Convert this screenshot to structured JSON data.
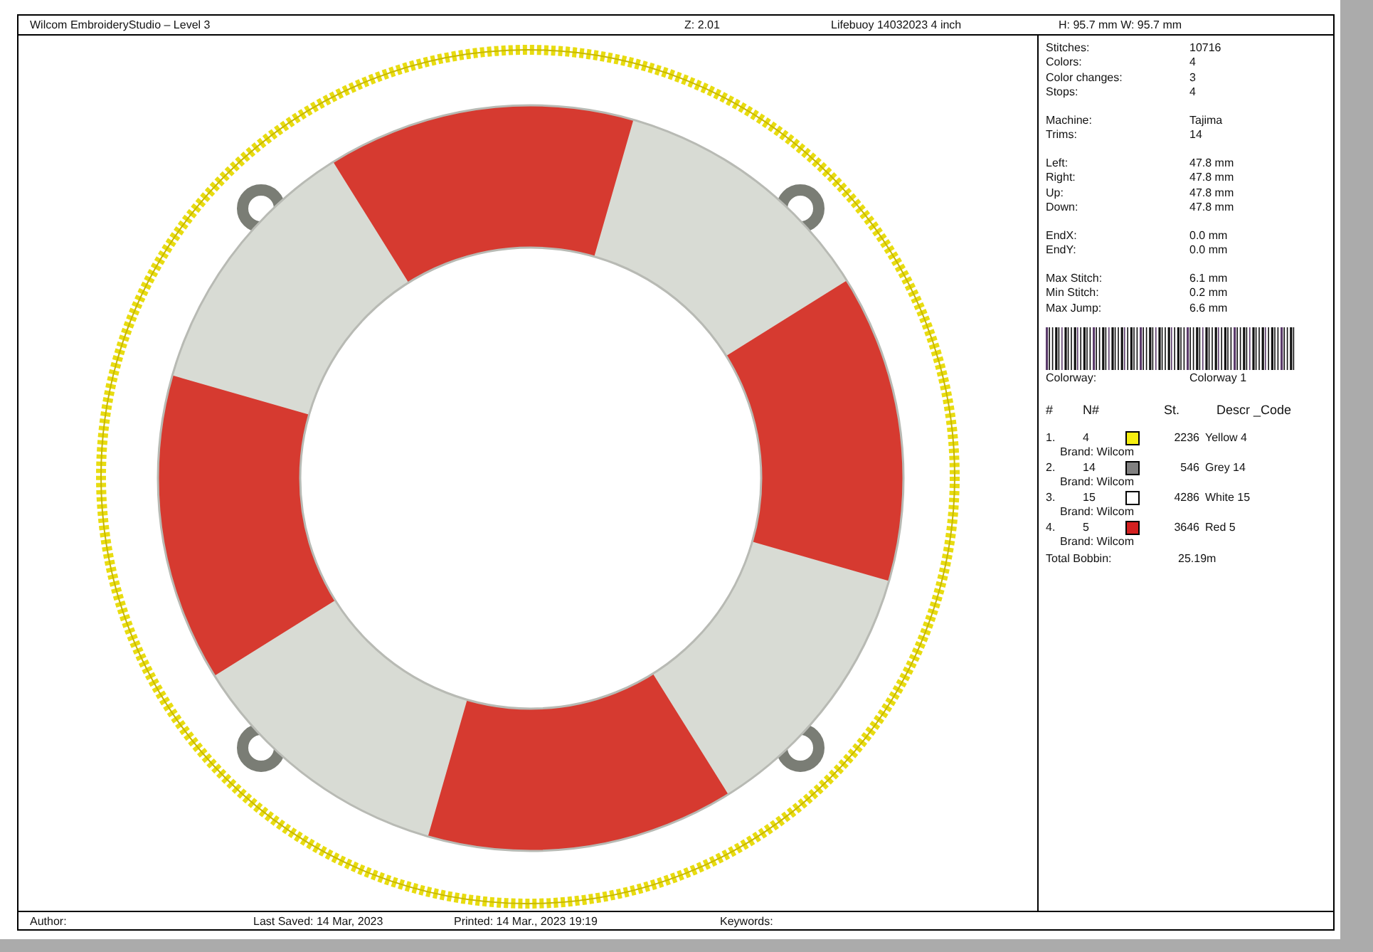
{
  "header": {
    "title": "Wilcom EmbroideryStudio – Level 3",
    "zoom": "Z: 2.01",
    "design_name": "Lifebuoy 14032023 4 inch",
    "size": "H: 95.7 mm   W: 95.7 mm"
  },
  "stat_groups": [
    [
      {
        "label": "Stitches:",
        "value": "10716"
      },
      {
        "label": "Colors:",
        "value": "4"
      },
      {
        "label": "Color changes:",
        "value": "3"
      },
      {
        "label": "Stops:",
        "value": "4"
      }
    ],
    [
      {
        "label": "Machine:",
        "value": "Tajima"
      },
      {
        "label": "Trims:",
        "value": "14"
      }
    ],
    [
      {
        "label": "Left:",
        "value": "47.8 mm"
      },
      {
        "label": "Right:",
        "value": "47.8 mm"
      },
      {
        "label": "Up:",
        "value": "47.8 mm"
      },
      {
        "label": "Down:",
        "value": "47.8 mm"
      }
    ],
    [
      {
        "label": "EndX:",
        "value": "0.0 mm"
      },
      {
        "label": "EndY:",
        "value": "0.0 mm"
      }
    ],
    [
      {
        "label": "Max Stitch:",
        "value": "6.1 mm"
      },
      {
        "label": "Min Stitch:",
        "value": "0.2 mm"
      },
      {
        "label": "Max Jump:",
        "value": "6.6 mm"
      }
    ]
  ],
  "colorway": {
    "label": "Colorway:",
    "value": "Colorway 1"
  },
  "thread_columns": [
    "#",
    "N#",
    "St.",
    "Descr _Code"
  ],
  "threads": [
    {
      "index": "1.",
      "number": "4",
      "color": "#f5ee10",
      "stitches": "2236",
      "description": "Yellow 4",
      "brand": "Brand: Wilcom"
    },
    {
      "index": "2.",
      "number": "14",
      "color": "#808080",
      "stitches": "546",
      "description": "Grey 14",
      "brand": "Brand: Wilcom"
    },
    {
      "index": "3.",
      "number": "15",
      "color": "#ffffff",
      "stitches": "4286",
      "description": "White 15",
      "brand": "Brand: Wilcom"
    },
    {
      "index": "4.",
      "number": "5",
      "color": "#d42020",
      "stitches": "3646",
      "description": "Red 5",
      "brand": "Brand: Wilcom"
    }
  ],
  "total_bobbin": {
    "label": "Total Bobbin:",
    "value": "25.19m"
  },
  "footer": {
    "author": "Author:",
    "last_saved": "Last Saved: 14 Mar, 2023",
    "printed": "Printed:  14 Mar., 2023 19:19",
    "keywords": "Keywords:"
  }
}
